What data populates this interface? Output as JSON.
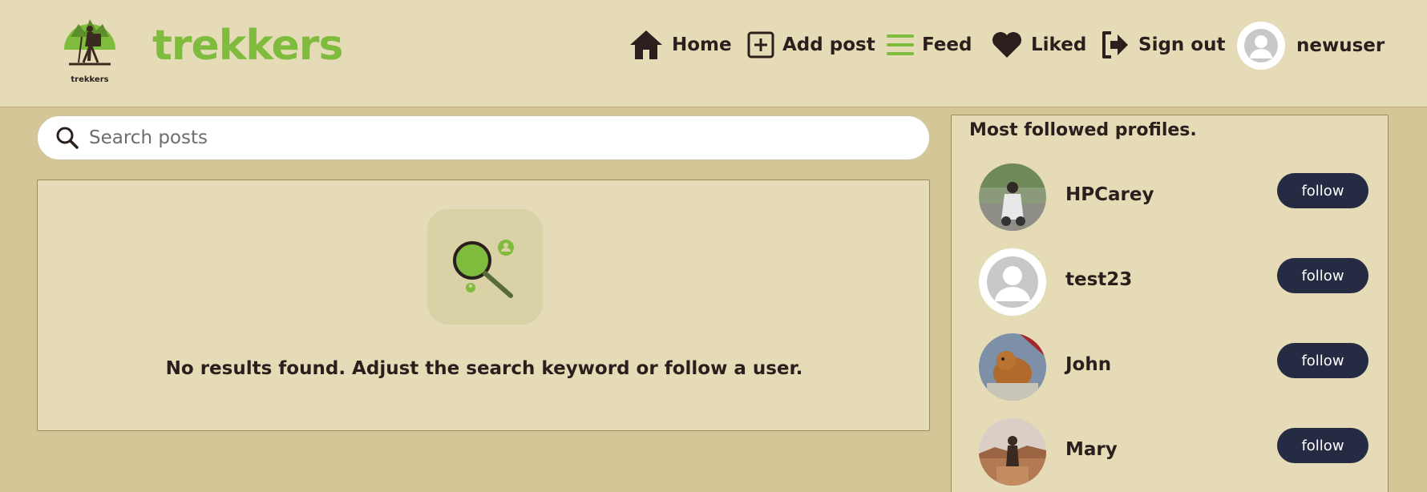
{
  "brand": {
    "logo_text": "trekkers",
    "name": "trekkers",
    "color": "#7fbb3c"
  },
  "nav": {
    "home": "Home",
    "add_post": "Add post",
    "feed": "Feed",
    "liked": "Liked",
    "sign_out": "Sign out",
    "username": "newuser"
  },
  "search": {
    "placeholder": "Search posts",
    "value": ""
  },
  "results": {
    "empty_message": "No results found. Adjust the search keyword or follow a user."
  },
  "sidebar": {
    "title": "Most followed profiles.",
    "profiles": [
      {
        "name": "HPCarey",
        "button": "follow",
        "avatar": "photo-person-scooter"
      },
      {
        "name": "test23",
        "button": "follow",
        "avatar": "default-avatar"
      },
      {
        "name": "John",
        "button": "follow",
        "avatar": "photo-cat"
      },
      {
        "name": "Mary",
        "button": "follow",
        "avatar": "photo-person-canyon"
      }
    ]
  },
  "colors": {
    "page_bg": "#d4c697",
    "panel_bg": "#e5dcb7",
    "accent": "#7fbb3c",
    "button_bg": "#252b42",
    "text": "#2a1f1d"
  }
}
